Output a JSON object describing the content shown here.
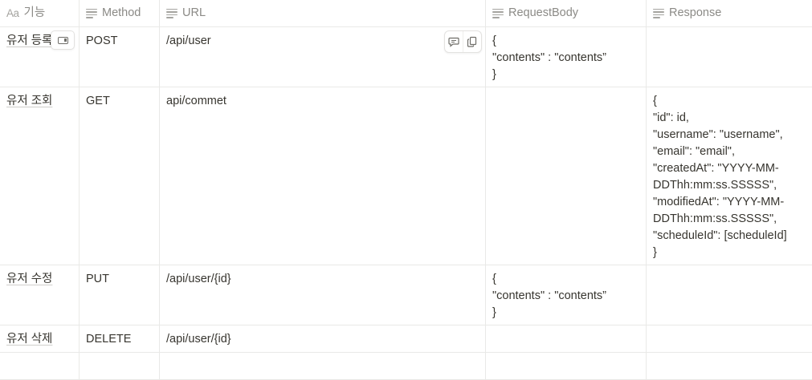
{
  "columns": [
    {
      "icon": "title-aa-icon",
      "prefix": "Aa",
      "label": "기능"
    },
    {
      "icon": "text-lines-icon",
      "label": "Method"
    },
    {
      "icon": "text-lines-icon",
      "label": "URL"
    },
    {
      "icon": "text-lines-icon",
      "label": "RequestBody"
    },
    {
      "icon": "text-lines-icon",
      "label": "Response"
    }
  ],
  "rows": [
    {
      "name": "유저 등록",
      "method": "POST",
      "url": "/api/user",
      "request": "{\n\"contents\" : \"contents”\n}",
      "response": ""
    },
    {
      "name": "유저 조회",
      "method": "GET",
      "url": "api/commet",
      "request": "",
      "response": "{\n\"id\": id,\n\"username\": \"username\",\n\"email\": \"email\",\n\"createdAt\": \"YYYY-MM-DDThh:mm:ss.SSSSS\",\n\"modifiedAt\": \"YYYY-MM-DDThh:mm:ss.SSSSS\",\n\"scheduleId\": [scheduleId]\n}"
    },
    {
      "name": "유저 수정",
      "method": "PUT",
      "url": "/api/user/{id}",
      "request": "{\n\"contents\" : \"contents”\n}",
      "response": ""
    },
    {
      "name": "유저 삭제",
      "method": "DELETE",
      "url": "/api/user/{id}",
      "request": "",
      "response": ""
    },
    {
      "name": "",
      "method": "",
      "url": "",
      "request": "",
      "response": ""
    }
  ],
  "row_tools": {
    "open_icon": "open-page-icon",
    "comment_icon": "comment-icon",
    "copy_icon": "copy-icon"
  }
}
